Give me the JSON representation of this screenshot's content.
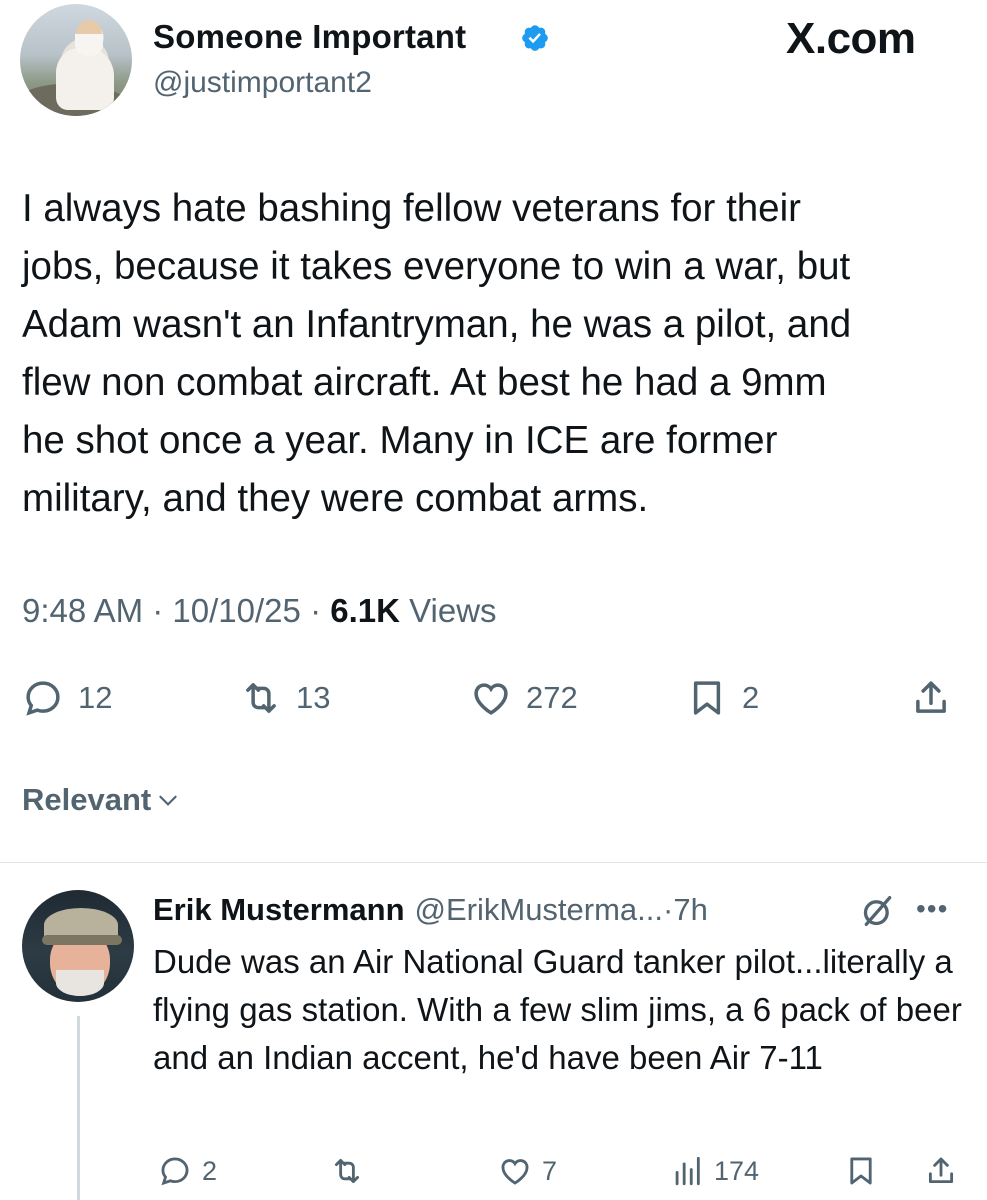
{
  "tweet": {
    "author": {
      "name": "Someone Important",
      "handle": "@justimportant2",
      "verified": true,
      "avatar_icon": "avatar-sage"
    },
    "brand": "X.com",
    "text": "I always hate bashing fellow veterans for their\njobs,  because it takes everyone to win a war, but\nAdam wasn't an Infantryman, he was a pilot, and\nflew non combat aircraft. At best he had a 9mm\nhe shot once a year. Many in ICE are former\nmilitary, and they were combat arms.",
    "time": "9:48 AM",
    "date": "10/10/25",
    "views_count": "6.1K",
    "views_label": "Views",
    "actions": {
      "replies": "12",
      "reposts": "13",
      "likes": "272",
      "bookmarks": "2"
    }
  },
  "sort_label": "Relevant",
  "reply": {
    "name": "Erik Mustermann",
    "handle": "@ErikMusterma...",
    "time": "7h",
    "text": "Dude was an Air National Guard tanker pilot...literally a flying gas station.  With a few slim jims, a 6 pack of beer and an Indian accent, he'd have been Air 7-11",
    "actions": {
      "replies": "2",
      "likes": "7",
      "views": "174"
    }
  },
  "colors": {
    "accent": "#1d9bf0",
    "secondary_text": "#536471",
    "primary_text": "#0f1419"
  }
}
